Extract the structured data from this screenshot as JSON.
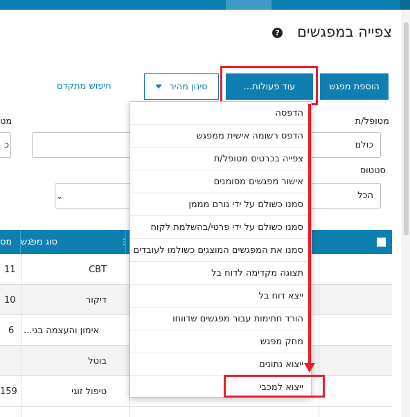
{
  "header": {
    "title": "צפייה במפגשים",
    "help_icon": "?"
  },
  "toolbar": {
    "add_label": "הוספת מפגש",
    "more_label": "עוד פעולות...",
    "quick_filter_label": "סינון מהיר",
    "advanced_search_label": "חיפוש מתקדם"
  },
  "filters": {
    "patient_label": "מטופל/ת",
    "patient_value": "כולם",
    "status_label": "סטטוס",
    "status_value": "הכל",
    "left_label_partial": "מט",
    "left_value_partial": "כ"
  },
  "table": {
    "columns": {
      "meeting_type": "סוג מפגש",
      "left_partial": "מס"
    },
    "rows": [
      {
        "meeting_type": "CBT",
        "left": "11"
      },
      {
        "meeting_type": "דיקור",
        "left": "10"
      },
      {
        "meeting_type": "אימון והעצמה בגי...",
        "left": "6"
      },
      {
        "meeting_type": "בוטל",
        "left": ""
      },
      {
        "meeting_type": "טיפול זוגי",
        "left": "159"
      }
    ]
  },
  "actions_menu": {
    "items": [
      "הדפסה",
      "הדפס רשומה אישית ממפגש",
      "צפייה בכרטיס מטופל/ת",
      "אישור מפגשים מסומנים",
      "סמנו כשולם על ידי גורם מממן",
      "סמנו כשולם על ידי פרטי/בהשלמת לקוח",
      "סמנו את המפגשים המוצגים כשולמו לעובדים",
      "תצוגה מקדימה לדוח בל",
      "ייצא דוח בל",
      "הורד חתימות עבור מפגשים שדווחו",
      "מחק מפגש",
      "ייצוא נתונים",
      "ייצוא למכבי"
    ]
  },
  "colors": {
    "primary": "#0e7fb0",
    "highlight": "#e8202a"
  }
}
